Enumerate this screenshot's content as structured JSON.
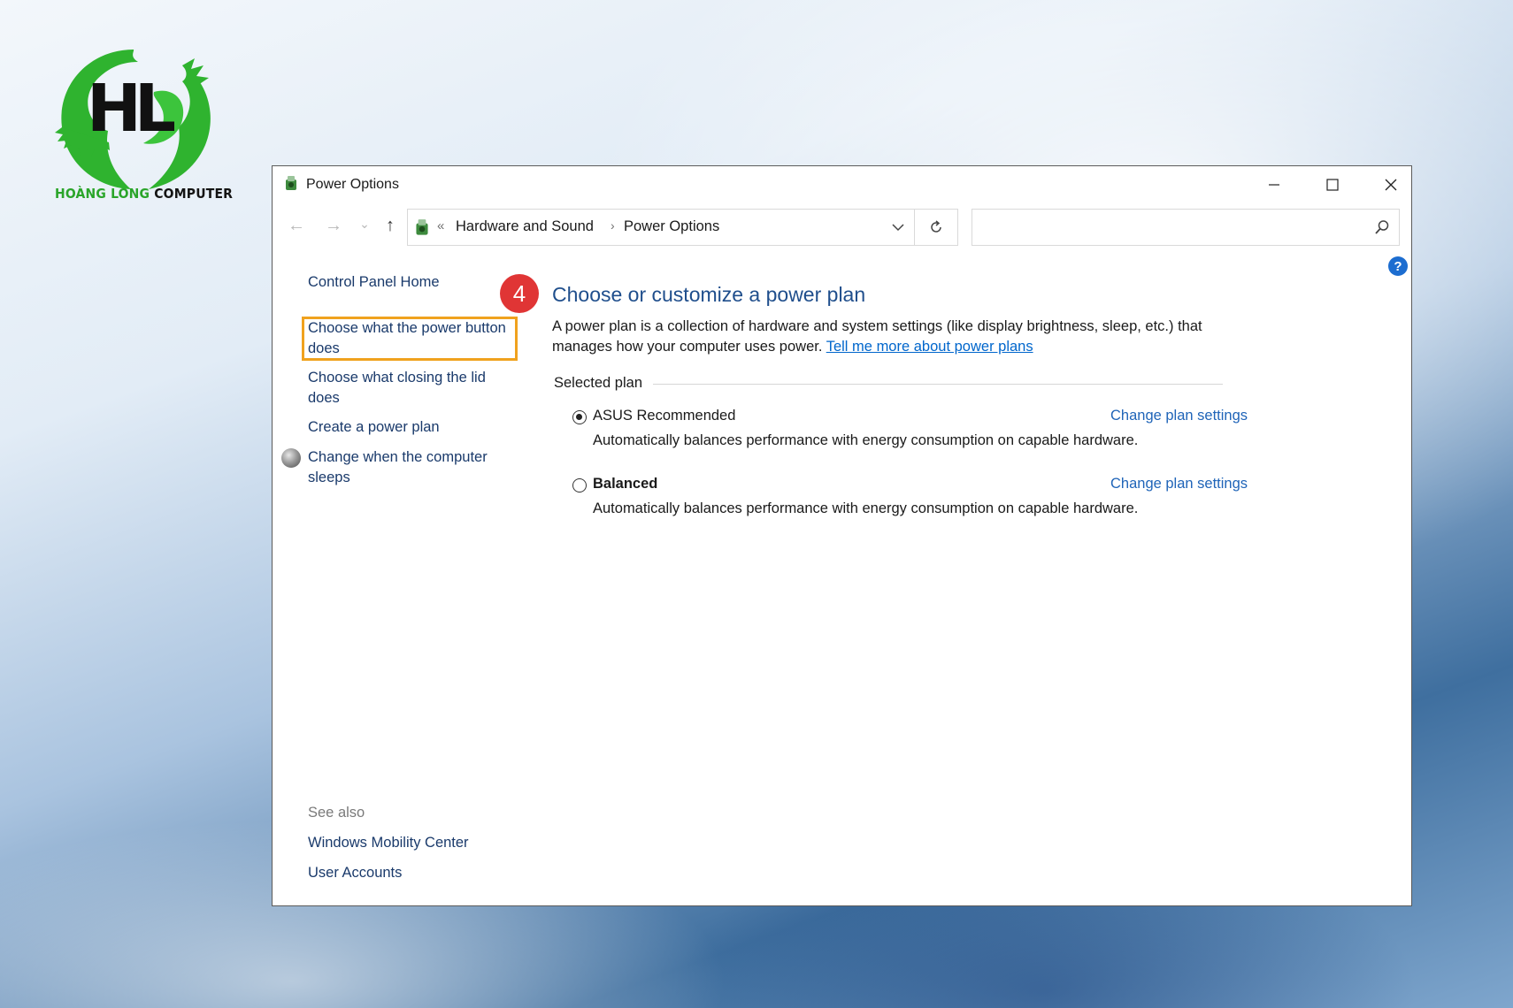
{
  "logo": {
    "text_part1": "HOÀNG LONG",
    "text_part2": "COMPUTER",
    "monogram": "HL",
    "brand_green": "#2aa52a"
  },
  "window": {
    "title": "Power Options",
    "controls": {
      "minimize": "minimize-icon",
      "maximize": "maximize-icon",
      "close": "close-icon"
    }
  },
  "navigation": {
    "back": "←",
    "forward": "→",
    "history": "⌄",
    "up": "↑",
    "breadcrumb_prefix": "«",
    "breadcrumbs": [
      "Hardware and Sound",
      "Power Options"
    ],
    "breadcrumb_chevron": "›",
    "search_placeholder": ""
  },
  "help": {
    "label": "?"
  },
  "left_pane": {
    "home": "Control Panel Home",
    "links": [
      "Choose what the power button does",
      "Choose what closing the lid does",
      "Create a power plan",
      "Change when the computer sleeps"
    ],
    "see_also_label": "See also",
    "see_also": [
      "Windows Mobility Center",
      "User Accounts"
    ],
    "highlight_color": "#f0a21e"
  },
  "step_badge": {
    "number": "4",
    "color": "#e03535"
  },
  "main": {
    "title": "Choose or customize a power plan",
    "description": "A power plan is a collection of hardware and system settings (like display brightness, sleep, etc.) that manages how your computer uses power.",
    "learn_more": "Tell me more about power plans",
    "selected_plan_label": "Selected plan",
    "plans": [
      {
        "name": "ASUS Recommended",
        "checked": true,
        "bold": false,
        "description": "Automatically balances performance with energy consumption on capable hardware.",
        "link": "Change plan settings"
      },
      {
        "name": "Balanced",
        "checked": false,
        "bold": true,
        "description": "Automatically balances performance with energy consumption on capable hardware.",
        "link": "Change plan settings"
      }
    ]
  }
}
